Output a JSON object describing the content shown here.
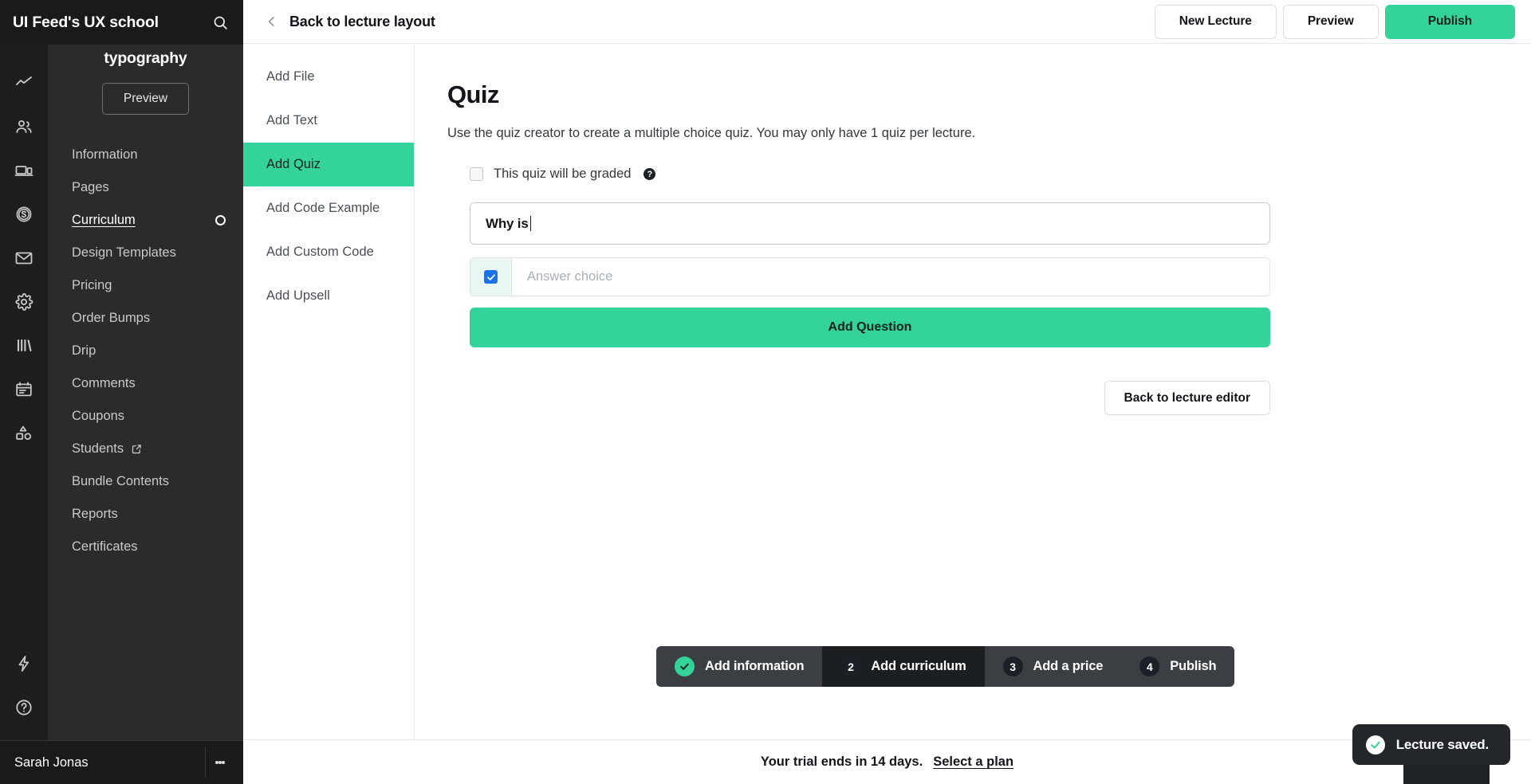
{
  "brand": {
    "title": "UI Feed's UX school",
    "search_icon": "search-icon"
  },
  "sidebar": {
    "course_title": "Introduction to typography",
    "preview_label": "Preview",
    "nav_items": [
      {
        "label": "Information",
        "active": false
      },
      {
        "label": "Pages",
        "active": false
      },
      {
        "label": "Curriculum",
        "active": true
      },
      {
        "label": "Design Templates",
        "active": false
      },
      {
        "label": "Pricing",
        "active": false
      },
      {
        "label": "Order Bumps",
        "active": false
      },
      {
        "label": "Drip",
        "active": false
      },
      {
        "label": "Comments",
        "active": false
      },
      {
        "label": "Coupons",
        "active": false
      },
      {
        "label": "Students",
        "active": false
      },
      {
        "label": "Bundle Contents",
        "active": false
      },
      {
        "label": "Reports",
        "active": false
      },
      {
        "label": "Certificates",
        "active": false
      }
    ],
    "user_name": "Sarah Jonas",
    "menu_icon": "kebab-menu-icon"
  },
  "rail": {
    "icons": [
      "analytics-icon",
      "people-icon",
      "devices-icon",
      "dollar-coin-icon",
      "mail-icon",
      "gear-icon",
      "library-icon",
      "calendar-icon",
      "shapes-icon"
    ],
    "bottom_icons": [
      "lightning-icon",
      "help-circle-icon",
      "graduation-cap-icon"
    ]
  },
  "topbar": {
    "back_label": "Back to lecture layout",
    "back_icon": "chevron-left-icon",
    "new_lecture_label": "New Lecture",
    "preview_label": "Preview",
    "publish_label": "Publish"
  },
  "add_panel": {
    "items": [
      {
        "label": "Add File",
        "active": false
      },
      {
        "label": "Add Text",
        "active": false
      },
      {
        "label": "Add Quiz",
        "active": true
      },
      {
        "label": "Add Code Example",
        "active": false
      },
      {
        "label": "Add Custom Code",
        "active": false
      },
      {
        "label": "Add Upsell",
        "active": false
      }
    ]
  },
  "quiz": {
    "title": "Quiz",
    "description": "Use the quiz creator to create a multiple choice quiz. You may only have 1 quiz per lecture.",
    "graded_label": "This quiz will be graded",
    "graded_checked": false,
    "help_icon": "question-mark-icon",
    "question_value": "Why is",
    "answer_choices": [
      {
        "checked": true,
        "value": "",
        "placeholder": "Answer choice"
      }
    ],
    "add_question_label": "Add Question",
    "back_to_editor_label": "Back to lecture editor"
  },
  "stepper": {
    "steps": [
      {
        "badge": "✓",
        "label": "Add information",
        "state": "done"
      },
      {
        "badge": "2",
        "label": "Add curriculum",
        "state": "current"
      },
      {
        "badge": "3",
        "label": "Add a price",
        "state": "upcoming"
      },
      {
        "badge": "4",
        "label": "Publish",
        "state": "upcoming"
      }
    ]
  },
  "trial": {
    "text": "Your trial ends in 14 days.",
    "link": "Select a plan"
  },
  "toast": {
    "message": "Lecture saved.",
    "icon": "check-circle-icon"
  },
  "help_launcher": {
    "icon": "chat-bubble-icon"
  },
  "colors": {
    "accent_green": "#34d399",
    "checkbox_blue": "#1a73e8",
    "rail_bg": "#1e1e1e",
    "sidebar_bg": "#2b2b2b",
    "brandbar_bg": "#1a1a1a",
    "toast_bg": "#23272b"
  }
}
